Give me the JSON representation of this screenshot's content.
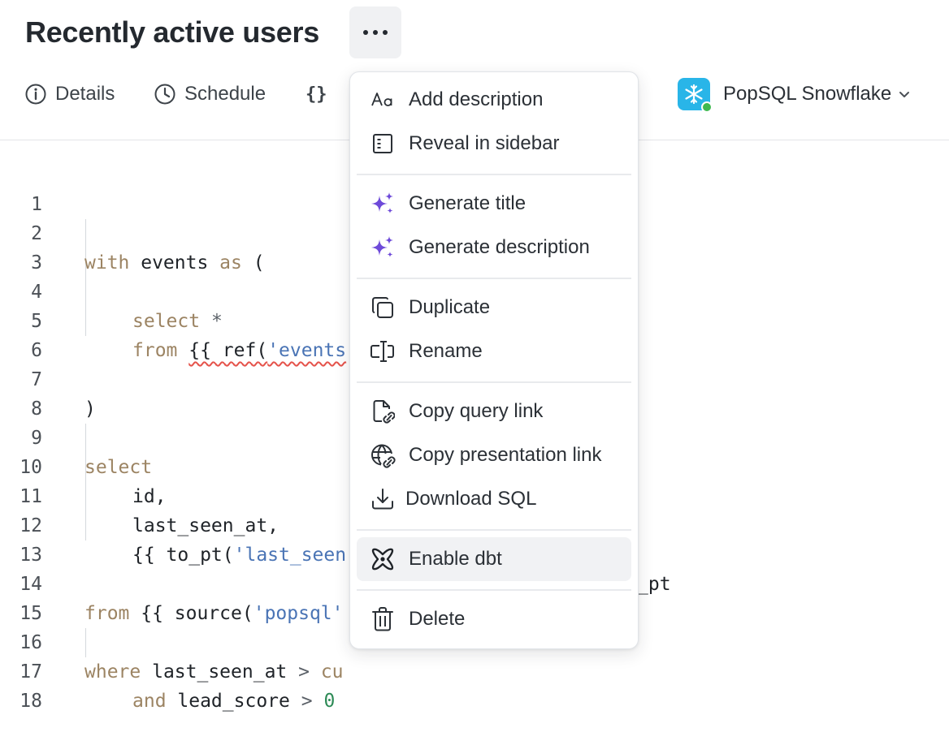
{
  "header": {
    "title": "Recently active users",
    "more_icon": "ellipsis-icon"
  },
  "tabs": [
    {
      "label": "Details",
      "icon": "info-circle-icon"
    },
    {
      "label": "Schedule",
      "icon": "clock-icon"
    },
    {
      "label": "{}",
      "icon": "braces"
    }
  ],
  "connection": {
    "name": "PopSQL Snowflake",
    "logo": "snowflake-icon",
    "status_color": "#3fb950",
    "brand_color": "#29b5e8"
  },
  "editor": {
    "line_numbers": [
      "1",
      "2",
      "3",
      "4",
      "5",
      "6",
      "7",
      "8",
      "9",
      "10",
      "11",
      "12",
      "13",
      "14",
      "15",
      "16",
      "17",
      "18"
    ],
    "lines": {
      "l2": {
        "a": "with",
        "b": " events ",
        "c": "as",
        "d": " ("
      },
      "l4": {
        "a": "select",
        "b": " *"
      },
      "l5": {
        "a": "from",
        "b": " ",
        "c": "{{ ref(",
        "d": "'events"
      },
      "l7": {
        "a": ")"
      },
      "l9": {
        "a": "select"
      },
      "l10": {
        "a": "id,"
      },
      "l11": {
        "a": "last_seen_at,"
      },
      "l12": {
        "a": "{{ to_pt(",
        "b": "'last_seen",
        "c": "_pt"
      },
      "l14": {
        "a": "from",
        "b": " {{ source(",
        "c": "'popsql'"
      },
      "l16": {
        "a": "where",
        "b": " last_seen_at ",
        "c": ">",
        "d": " cu"
      },
      "l17": {
        "a": "and",
        "b": " lead_score ",
        "c": ">",
        "d": " ",
        "e": "0"
      }
    }
  },
  "menu": {
    "items": [
      {
        "label": "Add description",
        "icon": "text-aa-icon"
      },
      {
        "label": "Reveal in sidebar",
        "icon": "sidebar-icon"
      },
      {
        "label": "Generate title",
        "icon": "sparkles-icon"
      },
      {
        "label": "Generate description",
        "icon": "sparkles-icon"
      },
      {
        "label": "Duplicate",
        "icon": "copy-icon"
      },
      {
        "label": "Rename",
        "icon": "text-cursor-icon"
      },
      {
        "label": "Copy query link",
        "icon": "file-link-icon"
      },
      {
        "label": "Copy presentation link",
        "icon": "globe-link-icon"
      },
      {
        "label": "Download SQL",
        "icon": "download-icon"
      },
      {
        "label": "Enable dbt",
        "icon": "dbt-icon"
      },
      {
        "label": "Delete",
        "icon": "trash-icon"
      }
    ],
    "accent_color": "#6e4ad9"
  }
}
